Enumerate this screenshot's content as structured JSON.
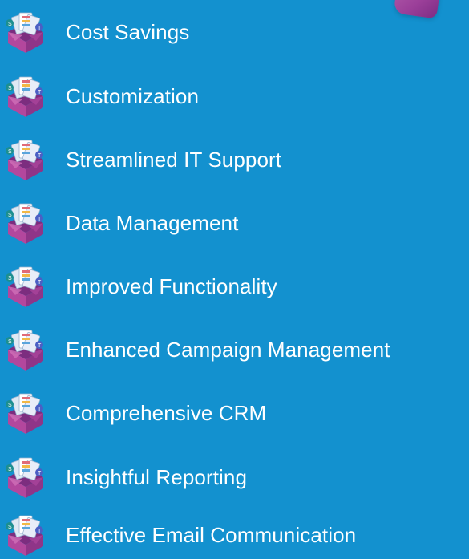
{
  "items": [
    {
      "label": "Cost Savings",
      "icon": "apps-box-icon"
    },
    {
      "label": "Customization",
      "icon": "apps-box-icon"
    },
    {
      "label": "Streamlined IT Support",
      "icon": "apps-box-icon"
    },
    {
      "label": "Data Management",
      "icon": "apps-box-icon"
    },
    {
      "label": "Improved Functionality",
      "icon": "apps-box-icon"
    },
    {
      "label": "Enhanced Campaign Management",
      "icon": "apps-box-icon"
    },
    {
      "label": "Comprehensive CRM",
      "icon": "apps-box-icon"
    },
    {
      "label": "Insightful Reporting",
      "icon": "apps-box-icon"
    },
    {
      "label": "Effective Email Communication",
      "icon": "apps-box-icon"
    }
  ],
  "colors": {
    "background": "#1391cf",
    "text": "#ffffff",
    "box": "#b3479d",
    "box_dark": "#7c2d7f",
    "corner_shape": "#9b3f99"
  }
}
